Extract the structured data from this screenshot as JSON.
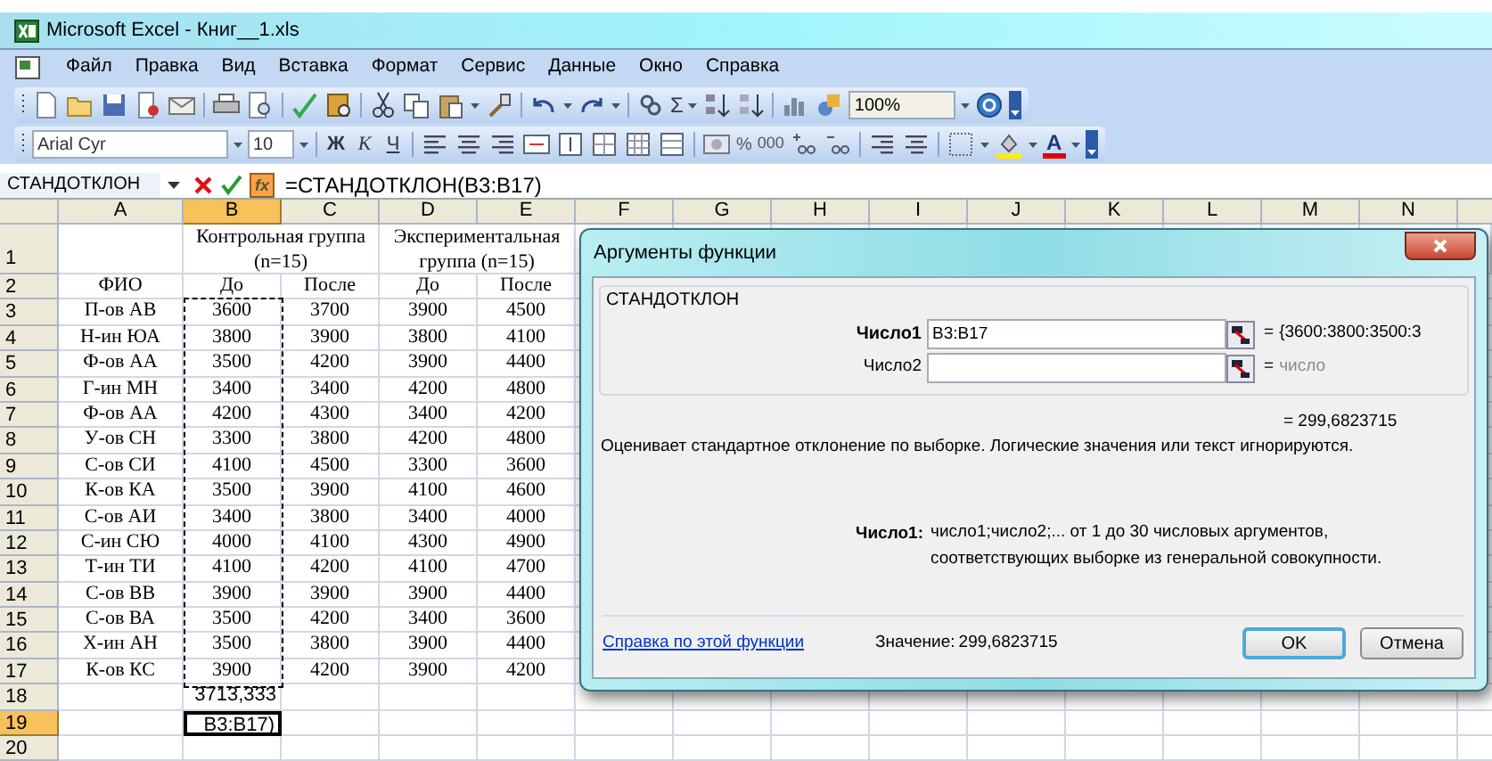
{
  "window": {
    "title": "Microsoft Excel - Книг__1.xls"
  },
  "menu": [
    {
      "label": "Файл"
    },
    {
      "label": "Правка"
    },
    {
      "label": "Вид"
    },
    {
      "label": "Вставка"
    },
    {
      "label": "Формат"
    },
    {
      "label": "Сервис"
    },
    {
      "label": "Данные"
    },
    {
      "label": "Окно"
    },
    {
      "label": "Справка"
    }
  ],
  "standard_toolbar": {
    "sum": "Σ",
    "zoom": "100%"
  },
  "format_toolbar": {
    "font": "Arial Cyr",
    "size": "10",
    "bold": "Ж",
    "italic": "К",
    "underline": "Ч",
    "percent": "%",
    "thousands": "000",
    "font_color": "A"
  },
  "formula_bar": {
    "name_box": "СТАНДОТКЛОН",
    "function_button": "fx",
    "formula": "=СТАНДОТКЛОН(B3:B17)"
  },
  "sheet": {
    "columns": [
      {
        "label": "A",
        "selected": false
      },
      {
        "label": "B",
        "selected": true
      },
      {
        "label": "C",
        "selected": false
      },
      {
        "label": "D",
        "selected": false
      },
      {
        "label": "E",
        "selected": false
      },
      {
        "label": "F",
        "selected": false
      },
      {
        "label": "G",
        "selected": false
      },
      {
        "label": "H",
        "selected": false
      },
      {
        "label": "I",
        "selected": false
      },
      {
        "label": "J",
        "selected": false
      },
      {
        "label": "K",
        "selected": false
      },
      {
        "label": "L",
        "selected": false
      },
      {
        "label": "M",
        "selected": false
      },
      {
        "label": "N",
        "selected": false
      }
    ],
    "group_row": {
      "header": "1",
      "groups": [
        "Контрольная группа (n=15)",
        "Экспериментальная группа (n=15)"
      ]
    },
    "rows": [
      {
        "header": "2",
        "kind": "data",
        "selected": false,
        "cells": [
          "ФИО",
          "До",
          "После",
          "До",
          "После"
        ]
      },
      {
        "header": "3",
        "kind": "data",
        "selected": false,
        "cells": [
          "П-ов АВ",
          "3600",
          "3700",
          "3900",
          "4500"
        ]
      },
      {
        "header": "4",
        "kind": "data",
        "selected": false,
        "cells": [
          "Н-ин ЮА",
          "3800",
          "3900",
          "3800",
          "4100"
        ]
      },
      {
        "header": "5",
        "kind": "data",
        "selected": false,
        "cells": [
          "Ф-ов АА",
          "3500",
          "4200",
          "3900",
          "4400"
        ]
      },
      {
        "header": "6",
        "kind": "data",
        "selected": false,
        "cells": [
          "Г-ин МН",
          "3400",
          "3400",
          "4200",
          "4800"
        ]
      },
      {
        "header": "7",
        "kind": "data",
        "selected": false,
        "cells": [
          "Ф-ов АА",
          "4200",
          "4300",
          "3400",
          "4200"
        ]
      },
      {
        "header": "8",
        "kind": "data",
        "selected": false,
        "cells": [
          "У-ов СН",
          "3300",
          "3800",
          "4200",
          "4800"
        ]
      },
      {
        "header": "9",
        "kind": "data",
        "selected": false,
        "cells": [
          "С-ов СИ",
          "4100",
          "4500",
          "3300",
          "3600"
        ]
      },
      {
        "header": "10",
        "kind": "data",
        "selected": false,
        "cells": [
          "К-ов КА",
          "3500",
          "3900",
          "4100",
          "4600"
        ]
      },
      {
        "header": "11",
        "kind": "data",
        "selected": false,
        "cells": [
          "С-ов АИ",
          "3400",
          "3800",
          "3400",
          "4000"
        ]
      },
      {
        "header": "12",
        "kind": "data",
        "selected": false,
        "cells": [
          "С-ин СЮ",
          "4000",
          "4100",
          "4300",
          "4900"
        ]
      },
      {
        "header": "13",
        "kind": "data",
        "selected": false,
        "cells": [
          "Т-ин ТИ",
          "4100",
          "4200",
          "4100",
          "4700"
        ]
      },
      {
        "header": "14",
        "kind": "data",
        "selected": false,
        "cells": [
          "С-ов ВВ",
          "3900",
          "3900",
          "3900",
          "4400"
        ]
      },
      {
        "header": "15",
        "kind": "data",
        "selected": false,
        "cells": [
          "С-ов ВА",
          "3500",
          "4200",
          "3400",
          "3600"
        ]
      },
      {
        "header": "16",
        "kind": "data",
        "selected": false,
        "cells": [
          "Х-ин АН",
          "3500",
          "3800",
          "3900",
          "4400"
        ]
      },
      {
        "header": "17",
        "kind": "data",
        "selected": false,
        "cells": [
          "К-ов КС",
          "3900",
          "4200",
          "3900",
          "4200"
        ]
      },
      {
        "header": "18",
        "kind": "formula",
        "selected": false,
        "cells": [
          "",
          "3713,333",
          "",
          "",
          ""
        ]
      },
      {
        "header": "19",
        "kind": "formula",
        "selected": true,
        "cells": [
          "",
          "B3:B17)",
          "",
          "",
          ""
        ]
      },
      {
        "header": "20",
        "kind": "formula",
        "selected": false,
        "cells": [
          "",
          "",
          "",
          "",
          ""
        ]
      }
    ]
  },
  "dialog": {
    "title": "Аргументы функции",
    "function": "СТАНДОТКЛОН",
    "arguments": [
      {
        "label": "Число1",
        "active": true,
        "value": "B3:B17",
        "equals": "=",
        "result": "{3600:3800:3500:3"
      },
      {
        "label": "Число2",
        "active": false,
        "equals": "=",
        "result": "число"
      }
    ],
    "result": "= 299,6823715",
    "description": "Оценивает стандартное отклонение по выборке. Логические значения или текст игнорируются.",
    "argument_help": {
      "label": "Число1:",
      "text": "число1;число2;... от 1 до 30 числовых аргументов, соответствующих выборке из генеральной совокупности."
    },
    "help_link": "Справка по этой функции",
    "value_label": "Значение:",
    "value": "299,6823715",
    "buttons": [
      {
        "label": "OK",
        "default": true
      },
      {
        "label": "Отмена",
        "default": false
      }
    ]
  }
}
